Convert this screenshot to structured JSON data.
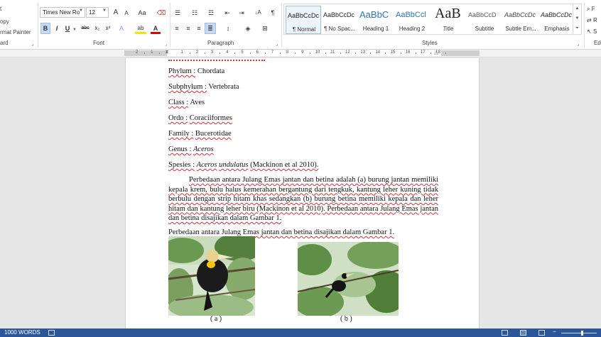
{
  "ribbon": {
    "clipboard": {
      "items": [
        "t",
        "opy",
        "rmat Painter"
      ],
      "group_label": "ard"
    },
    "font": {
      "font_name": "Times New Ro",
      "font_size": "12",
      "grow_label": "A",
      "shrink_label": "A",
      "case_label": "Aa",
      "bold": "B",
      "italic": "I",
      "underline": "U",
      "strike": "abc",
      "subscript": "x₂",
      "superscript": "x²",
      "effects": "A",
      "highlight": "ab",
      "font_color": "A",
      "group_label": "Font"
    },
    "paragraph": {
      "group_label": "Paragraph",
      "show_marks": "¶",
      "sort": "↓A"
    },
    "styles": {
      "group_label": "Styles",
      "tiles": [
        {
          "preview": "AaBbCcDc",
          "name": "¶ Normal"
        },
        {
          "preview": "AaBbCcDc",
          "name": "¶ No Spac..."
        },
        {
          "preview": "AaBbC",
          "name": "Heading 1"
        },
        {
          "preview": "AaBbCcl",
          "name": "Heading 2"
        },
        {
          "preview": "AaB",
          "name": "Title"
        },
        {
          "preview": "AaBbCcD",
          "name": "Subtitle"
        },
        {
          "preview": "AaBbCcDc",
          "name": "Subtle Em..."
        },
        {
          "preview": "AaBbCcDc",
          "name": "Emphasis"
        }
      ]
    },
    "editing": {
      "items": [
        "F",
        "R",
        "S"
      ],
      "group_label": "Ed"
    }
  },
  "ruler": {
    "numbers": [
      "2",
      "1",
      "1",
      "2",
      "3",
      "4",
      "5",
      "6",
      "7",
      "8",
      "9",
      "10",
      "11",
      "12",
      "13",
      "14",
      "15",
      "16",
      "17",
      "18"
    ]
  },
  "document": {
    "taxonomy": [
      {
        "label": "Phylum :",
        "value": "Chordata"
      },
      {
        "label": "Subphylum :",
        "value": "Vertebrata"
      },
      {
        "label": "Class :",
        "value": "Aves"
      },
      {
        "label": "Ordo :",
        "value": "Coraciiformes"
      },
      {
        "label": "Family :",
        "value": "Bucerotidae"
      },
      {
        "label": "Genus :",
        "value": "Aceros"
      }
    ],
    "species": {
      "label": "Spesies :",
      "genus": "Aceros",
      "species": "undulatus",
      "citation": "(Mackinon et al 2010)."
    },
    "paragraph": "Perbedaan antara Julang Emas jantan dan betina adalah (a) burung jantan memiliki kepala krem, bulu halus kemerahan bergantung dari tengkuk, kantung leher kuning tidak berbulu dengan strip hitam khas sedangkan (b) burung betina memiliki kepala dan leher hitam dan kantung leher biru (Mackinon et al 2010). Perbedaan antara Julang Emas jantan dan betina disajikan dalam Gambar 1.",
    "caption_line": "Perbedaan antara Julang Emas jantan dan betina disajikan dalam Gambar 1.",
    "figure_labels": [
      "( a )",
      "( b )"
    ]
  },
  "status": {
    "words": "1000 WORDS"
  },
  "colors": {
    "accent": "#2b579a",
    "spelling": "#d13438",
    "grammar": "#3d6fd8",
    "style_selected": "#c5d9f0"
  }
}
